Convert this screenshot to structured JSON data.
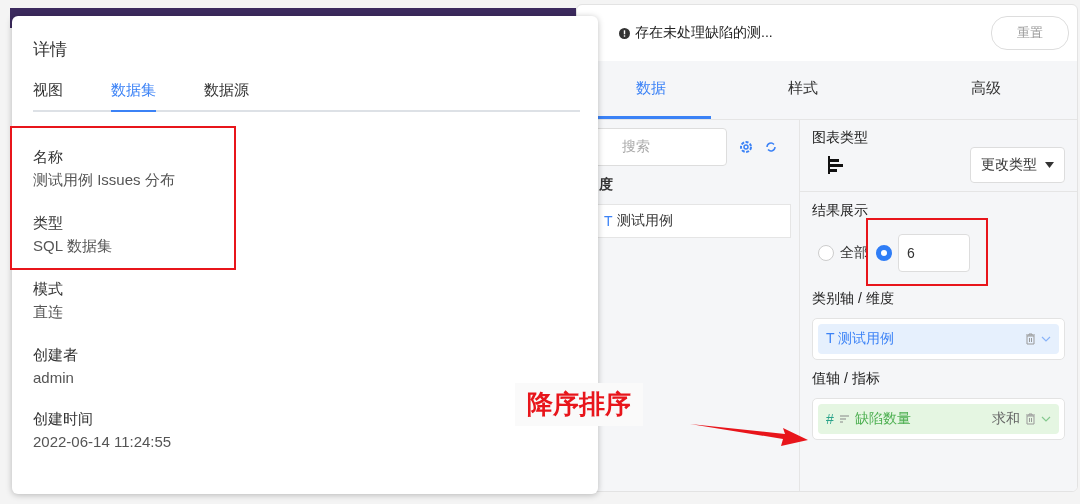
{
  "details_popup": {
    "title": "详情",
    "tabs": [
      {
        "label": "视图",
        "selected": false
      },
      {
        "label": "数据集",
        "selected": true
      },
      {
        "label": "数据源",
        "selected": false
      }
    ],
    "field_groups": [
      {
        "highlighted": true,
        "fields": [
          {
            "label": "名称",
            "value": "测试用例 Issues 分布"
          },
          {
            "label": "类型",
            "value": "SQL 数据集"
          }
        ]
      },
      {
        "highlighted": false,
        "fields": [
          {
            "label": "模式",
            "value": "直连"
          },
          {
            "label": "创建者",
            "value": "admin"
          },
          {
            "label": "创建时间",
            "value": "2022-06-14 11:24:55"
          }
        ]
      }
    ]
  },
  "editor": {
    "chart_title": "存在未处理缺陷的测...",
    "reset_button": "重置",
    "tabs": [
      {
        "label": "数据",
        "selected": true
      },
      {
        "label": "样式",
        "selected": false
      },
      {
        "label": "高级",
        "selected": false
      }
    ],
    "search": {
      "placeholder": "搜索"
    },
    "dimension_heading": "度",
    "dimension_fields": [
      {
        "type": "T",
        "name": "测试用例"
      }
    ],
    "chart_type": {
      "label": "图表类型",
      "change_button": "更改类型"
    },
    "result_display": {
      "label": "结果展示",
      "highlighted": true,
      "options": [
        {
          "label": "全部",
          "selected": false
        },
        {
          "selected": true,
          "value": "6"
        }
      ]
    },
    "category_axis": {
      "label": "类别轴 / 维度",
      "type": "T",
      "field": "测试用例"
    },
    "value_axis": {
      "label": "值轴 / 指标",
      "type": "#",
      "field": "缺陷数量",
      "aggregation": "求和",
      "sorted": true
    }
  },
  "annotation": {
    "text": "降序排序"
  }
}
